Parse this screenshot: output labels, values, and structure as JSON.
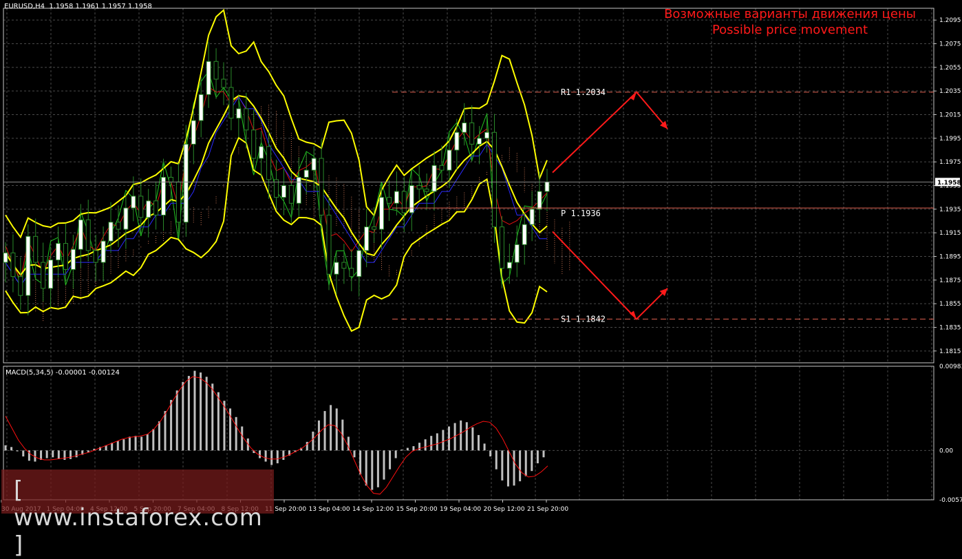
{
  "header": {
    "symbol_label": "EURUSD,H4  1.1958 1.1961 1.1957 1.1958",
    "macd_label": "MACD(5,34,5) -0.00001 -0.00124",
    "note_ru": "Возможные варианты движения цены",
    "note_en": "Possible price movement",
    "watermark": "[ www.instaforex.com ]"
  },
  "colors": {
    "background": "#000000",
    "grid": "#4a4a4a",
    "frame": "#c8c8c8",
    "text": "#ffffff",
    "candle_up": "#ffffff",
    "candle_down": "#2a8a2a",
    "bollinger": "#ffff00",
    "green_line": "#1fc41f",
    "red_line": "#e01010",
    "blue_line": "#2a2aff",
    "cloud": "#cc7755",
    "annotation": "#ff1a1a",
    "macd_hist": "#c0c0c0",
    "macd_signal": "#ff1010"
  },
  "chart_data": [
    {
      "type": "candlestick",
      "title": "EURUSD,H4",
      "ylim": [
        1.1805,
        1.2105
      ],
      "y_ticks": [
        "1.2095",
        "1.2075",
        "1.2055",
        "1.2035",
        "1.2015",
        "1.1995",
        "1.1975",
        "1.1955",
        "1.1935",
        "1.1915",
        "1.1895",
        "1.1875",
        "1.1855",
        "1.1835",
        "1.1815"
      ],
      "current_price": "1.1958",
      "x_ticks": [
        "30 Aug 2017",
        "1 Sep 04:00",
        "4 Sep 12:00",
        "5 Sep 20:00",
        "7 Sep 04:00",
        "8 Sep 12:00",
        "11 Sep 20:00",
        "13 Sep 04:00",
        "14 Sep 12:00",
        "15 Sep 20:00",
        "19 Sep 04:00",
        "20 Sep 12:00",
        "21 Sep 20:00"
      ],
      "close": [
        1.1898,
        1.1878,
        1.1862,
        1.1912,
        1.189,
        1.1868,
        1.1892,
        1.1906,
        1.1884,
        1.1901,
        1.1926,
        1.19,
        1.189,
        1.1908,
        1.1924,
        1.1918,
        1.1936,
        1.1946,
        1.1928,
        1.1942,
        1.193,
        1.1962,
        1.1958,
        1.1924,
        1.199,
        1.201,
        1.2032,
        1.206,
        1.2045,
        1.2038,
        1.2012,
        1.202,
        1.2002,
        1.1978,
        1.1988,
        1.196,
        1.1945,
        1.1955,
        1.194,
        1.1962,
        1.1968,
        1.1978,
        1.193,
        1.188,
        1.189,
        1.1885,
        1.1878,
        1.19,
        1.192,
        1.1918,
        1.1945,
        1.194,
        1.195,
        1.1932,
        1.1955,
        1.1952,
        1.195,
        1.1972,
        1.1968,
        1.1985,
        1.2,
        1.2008,
        1.199,
        1.1995,
        1.2,
        1.192,
        1.1885,
        1.189,
        1.1905,
        1.1922,
        1.1935,
        1.195,
        1.1958
      ],
      "levels": [
        {
          "label": "R1 1.2034",
          "value": 1.2034,
          "style": "dashed"
        },
        {
          "label": "P 1.1936",
          "value": 1.1936,
          "style": "solid"
        },
        {
          "label": "S1 1.1842",
          "value": 1.1842,
          "style": "dashed"
        }
      ],
      "scenario_arrows": [
        {
          "name": "up",
          "path": [
            [
              1.1966
            ],
            [
              1.2034
            ],
            [
              1.2003
            ]
          ]
        },
        {
          "name": "down",
          "path": [
            [
              1.1916
            ],
            [
              1.1842
            ],
            [
              1.1868
            ]
          ]
        }
      ]
    },
    {
      "type": "histogram+line",
      "title": "MACD(5,34,5)",
      "ylim": [
        -0.00576,
        0.00983
      ],
      "y_ticks": [
        "0.00983",
        "0.00",
        "-0.00576"
      ],
      "histogram": [
        0.0006,
        0.0004,
        -0.0001,
        -0.0007,
        -0.0012,
        -0.0013,
        -0.0011,
        -0.0009,
        -0.0008,
        -0.001,
        -0.0011,
        -0.001,
        -0.0008,
        -0.0005,
        -0.0002,
        0.0002,
        0.0004,
        0.0006,
        0.0009,
        0.0011,
        0.0013,
        0.0016,
        0.0017,
        0.0016,
        0.0019,
        0.0025,
        0.0034,
        0.0046,
        0.0059,
        0.007,
        0.008,
        0.0087,
        0.0093,
        0.0091,
        0.0086,
        0.0078,
        0.0068,
        0.0058,
        0.0049,
        0.0039,
        0.0028,
        0.0014,
        -0.0003,
        -0.0009,
        -0.0013,
        -0.0017,
        -0.0015,
        -0.0011,
        -0.0006,
        -0.0002,
        0.0003,
        0.001,
        0.0022,
        0.0035,
        0.0046,
        0.0053,
        0.0049,
        0.0036,
        0.0016,
        -0.0008,
        -0.0028,
        -0.0041,
        -0.0046,
        -0.0043,
        -0.0034,
        -0.0022,
        -0.0009,
        0.0001,
        0.0003,
        0.0005,
        0.0009,
        0.0013,
        0.0017,
        0.002,
        0.0024,
        0.0028,
        0.0032,
        0.0035,
        0.0033,
        0.0027,
        0.0018,
        0.0008,
        -0.0007,
        -0.0022,
        -0.0035,
        -0.0042,
        -0.0041,
        -0.0036,
        -0.003,
        -0.0024,
        -0.0015,
        -0.0008
      ],
      "signal": [
        0.004,
        0.0026,
        0.0012,
        0.0002,
        -0.0005,
        -0.0009,
        -0.0011,
        -0.0011,
        -0.001,
        -0.0009,
        -0.0008,
        -0.0006,
        -0.0004,
        -0.0002,
        0.0001,
        0.0004,
        0.0007,
        0.001,
        0.0013,
        0.0015,
        0.0016,
        0.0017,
        0.0019,
        0.0025,
        0.0034,
        0.0046,
        0.0059,
        0.0071,
        0.0081,
        0.0086,
        0.0085,
        0.008,
        0.0072,
        0.0061,
        0.005,
        0.0038,
        0.0025,
        0.0013,
        0.0003,
        -0.0004,
        -0.0008,
        -0.001,
        -0.001,
        -0.0008,
        -0.0005,
        -0.0001,
        0.0003,
        0.0009,
        0.0016,
        0.0024,
        0.003,
        0.0029,
        0.002,
        0.0006,
        -0.0011,
        -0.0028,
        -0.0041,
        -0.005,
        -0.0051,
        -0.0043,
        -0.0031,
        -0.0019,
        -0.0008,
        -0.0001,
        0.0002,
        0.0004,
        0.0006,
        0.0008,
        0.0011,
        0.0014,
        0.0018,
        0.0022,
        0.0027,
        0.0031,
        0.0034,
        0.0033,
        0.0026,
        0.0014,
        -0.0001,
        -0.0016,
        -0.0026,
        -0.0031,
        -0.003,
        -0.0025,
        -0.0018
      ]
    }
  ]
}
